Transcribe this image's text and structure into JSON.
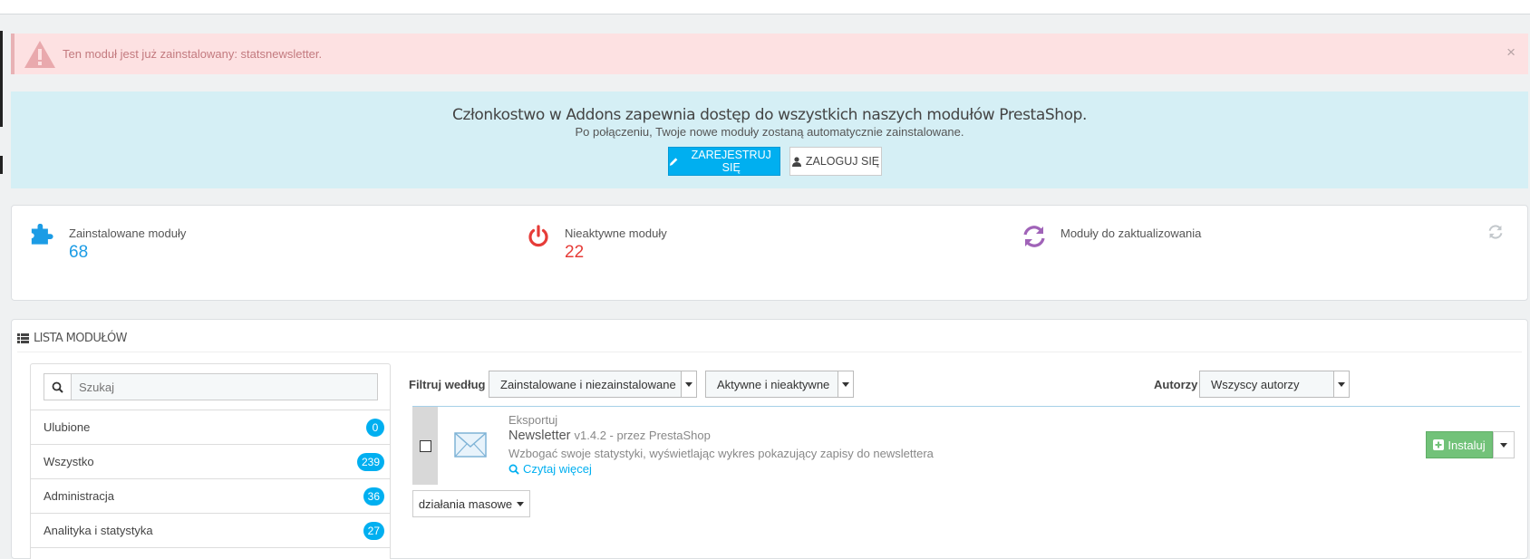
{
  "alert": {
    "message": "Ten moduł jest już zainstalowany: statsnewsletter.",
    "close": "×"
  },
  "addons": {
    "title": "Członkostwo w Addons zapewnia dostęp do wszystkich naszych modułów PrestaShop.",
    "subtitle": "Po połączeniu, Twoje nowe moduły zostaną automatycznie zainstalowane.",
    "register_label": "ZAREJESTRUJ SIĘ",
    "login_label": "ZALOGUJ SIĘ"
  },
  "stats": {
    "installed": {
      "label": "Zainstalowane moduły",
      "value": "68",
      "color": "#1c9ce5"
    },
    "inactive": {
      "label": "Nieaktywne moduły",
      "value": "22",
      "color": "#e63c38"
    },
    "to_update": {
      "label": "Moduły do zaktualizowania",
      "value": "",
      "color": "#a063b8"
    }
  },
  "list": {
    "title": "LISTA MODUŁÓW",
    "search_placeholder": "Szukaj",
    "categories": [
      {
        "label": "Ulubione",
        "count": "0"
      },
      {
        "label": "Wszystko",
        "count": "239"
      },
      {
        "label": "Administracja",
        "count": "36"
      },
      {
        "label": "Analityka i statystyka",
        "count": "27"
      },
      {
        "label": "",
        "count": ""
      }
    ]
  },
  "filter": {
    "label": "Filtruj według",
    "install_state": "Zainstalowane i niezainstalowane",
    "active_state": "Aktywne i nieaktywne",
    "authors_label": "Autorzy",
    "authors": "Wszyscy autorzy"
  },
  "module": {
    "category": "Eksportuj",
    "name": "Newsletter",
    "version": "v1.4.2 - przez PrestaShop",
    "description": "Wzbogać swoje statystyki, wyświetlając wykres pokazujący zapisy do newslettera",
    "read_more": "Czytaj więcej",
    "install_label": "Instaluj"
  },
  "bulk_label": "działania masowe"
}
